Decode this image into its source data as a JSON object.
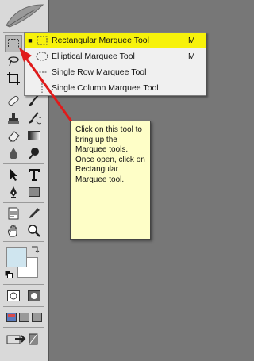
{
  "flyout": {
    "items": [
      {
        "label": "Rectangular Marquee Tool",
        "shortcut": "M",
        "selected": true,
        "icon": "rectangular-marquee-icon"
      },
      {
        "label": "Elliptical Marquee Tool",
        "shortcut": "M",
        "selected": false,
        "icon": "elliptical-marquee-icon"
      },
      {
        "label": "Single Row Marquee Tool",
        "shortcut": "",
        "selected": false,
        "icon": "single-row-marquee-icon"
      },
      {
        "label": "Single Column Marquee Tool",
        "shortcut": "",
        "selected": false,
        "icon": "single-column-marquee-icon"
      }
    ],
    "highlight_color": "#f7f20b"
  },
  "callout": {
    "text": "Click on this tool to bring up the Marquee tools. Once open, click on Rectangular Marquee tool."
  },
  "colors": {
    "foreground": "#cfe5ef",
    "background": "#ffffff",
    "arrow": "#e01b1b",
    "callout_fill": "#fefec7"
  }
}
